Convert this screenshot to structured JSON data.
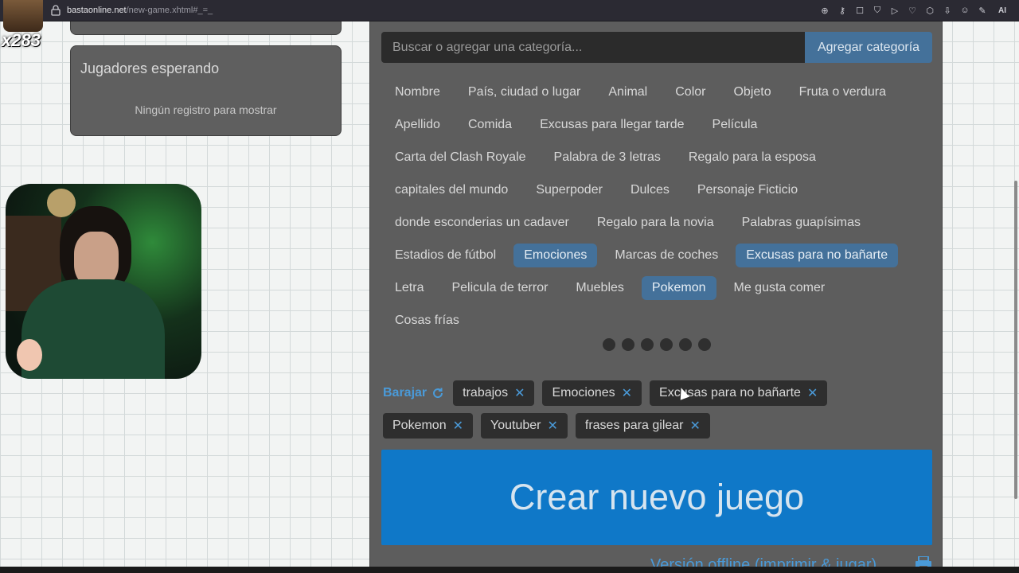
{
  "browser": {
    "url_host": "bastaonline.net",
    "url_path": "/new-game.xhtml#_=_",
    "toolbar_icons": [
      "zoom-icon",
      "key-icon",
      "bookmark-icon",
      "shield-icon",
      "play-icon",
      "heart-icon",
      "extension-icon",
      "download-icon",
      "account-icon",
      "pen-icon"
    ],
    "toolbar_text_badge": "AI"
  },
  "overlay": {
    "counter": "x283"
  },
  "players": {
    "title": "Jugadores esperando",
    "empty_message": "Ningún registro para mostrar"
  },
  "search": {
    "placeholder": "Buscar o agregar una categoría...",
    "value": "",
    "add_button": "Agregar categoría"
  },
  "categories": [
    [
      {
        "label": "Nombre",
        "selected": false
      },
      {
        "label": "País, ciudad o lugar",
        "selected": false
      },
      {
        "label": "Animal",
        "selected": false
      },
      {
        "label": "Color",
        "selected": false
      },
      {
        "label": "Objeto",
        "selected": false
      },
      {
        "label": "Fruta o verdura",
        "selected": false
      }
    ],
    [
      {
        "label": "Apellido",
        "selected": false
      },
      {
        "label": "Comida",
        "selected": false
      },
      {
        "label": "Excusas para llegar tarde",
        "selected": false
      },
      {
        "label": "Película",
        "selected": false
      }
    ],
    [
      {
        "label": "Carta del Clash Royale",
        "selected": false
      },
      {
        "label": "Palabra de 3 letras",
        "selected": false
      },
      {
        "label": "Regalo para la esposa",
        "selected": false
      }
    ],
    [
      {
        "label": "capitales del mundo",
        "selected": false
      },
      {
        "label": "Superpoder",
        "selected": false
      },
      {
        "label": "Dulces",
        "selected": false
      },
      {
        "label": "Personaje Ficticio",
        "selected": false
      }
    ],
    [
      {
        "label": "donde esconderias un cadaver",
        "selected": false
      },
      {
        "label": "Regalo para la novia",
        "selected": false
      },
      {
        "label": "Palabras guapísimas",
        "selected": false
      }
    ],
    [
      {
        "label": "Estadios de fútbol",
        "selected": false
      },
      {
        "label": "Emociones",
        "selected": true
      },
      {
        "label": "Marcas de coches",
        "selected": false
      },
      {
        "label": "Excusas para no bañarte",
        "selected": true
      }
    ],
    [
      {
        "label": "Letra",
        "selected": false
      },
      {
        "label": "Pelicula de terror",
        "selected": false
      },
      {
        "label": "Muebles",
        "selected": false
      },
      {
        "label": "Pokemon",
        "selected": true
      },
      {
        "label": "Me gusta comer",
        "selected": false
      }
    ],
    [
      {
        "label": "Cosas frías",
        "selected": false
      }
    ]
  ],
  "pagination": {
    "pages": 6
  },
  "selected": {
    "shuffle_label": "Barajar",
    "tags": [
      "trabajos",
      "Emociones",
      "Excusas para no bañarte",
      "Pokemon",
      "Youtuber",
      "frases para gilear"
    ]
  },
  "create_button": "Crear nuevo juego",
  "offline_link": "Versión offline (imprimir & jugar)"
}
